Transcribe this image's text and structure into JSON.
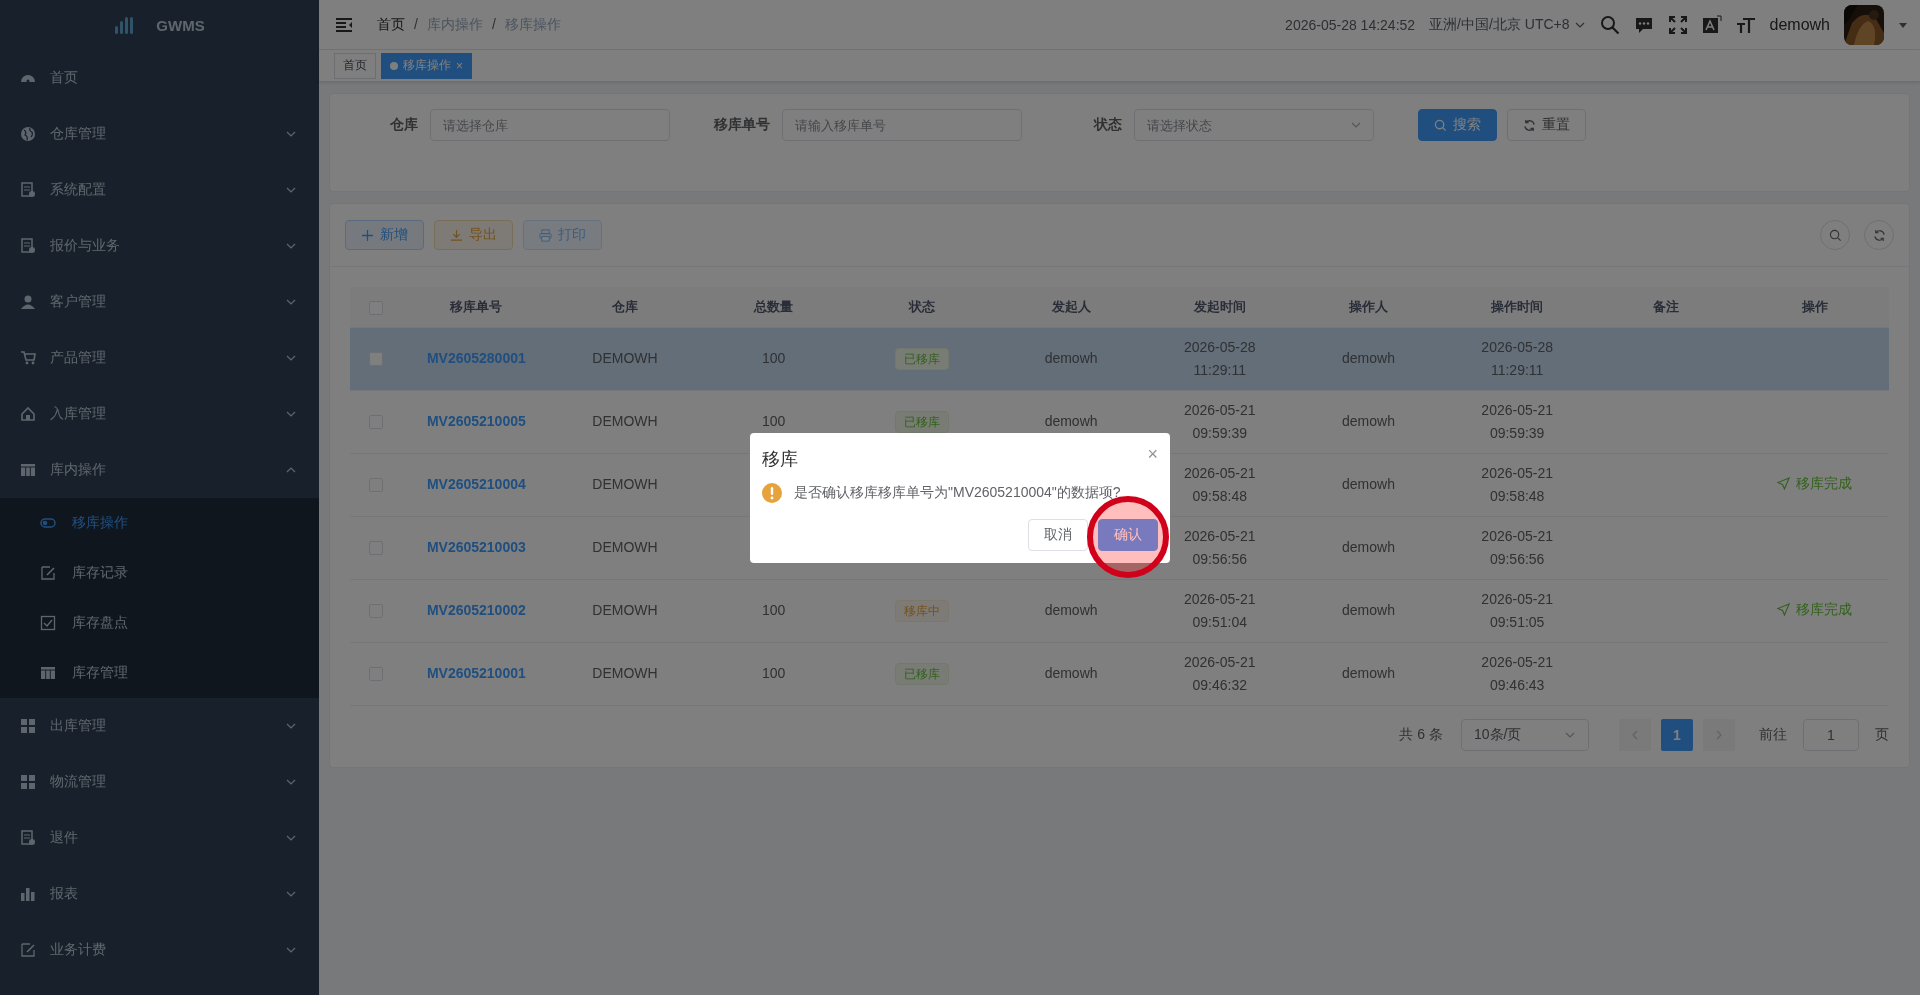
{
  "sidebar": {
    "logo": "GWMS",
    "items": [
      {
        "label": "首页"
      },
      {
        "label": "仓库管理",
        "expanded": false
      },
      {
        "label": "系统配置",
        "expanded": false
      },
      {
        "label": "报价与业务",
        "expanded": false
      },
      {
        "label": "客户管理",
        "expanded": false
      },
      {
        "label": "产品管理",
        "expanded": false
      },
      {
        "label": "入库管理",
        "expanded": false
      },
      {
        "label": "库内操作",
        "expanded": true,
        "children": [
          {
            "label": "移库操作",
            "selected": true
          },
          {
            "label": "库存记录",
            "selected": false
          },
          {
            "label": "库存盘点",
            "selected": false
          },
          {
            "label": "库存管理",
            "selected": false
          }
        ]
      },
      {
        "label": "出库管理",
        "expanded": false
      },
      {
        "label": "物流管理",
        "expanded": false
      },
      {
        "label": "退件",
        "expanded": false
      },
      {
        "label": "报表",
        "expanded": false
      },
      {
        "label": "业务计费",
        "expanded": false
      }
    ]
  },
  "header": {
    "breadcrumb": [
      "首页",
      "库内操作",
      "移库操作"
    ],
    "breadcrumb_separator": "/",
    "datetime": "2026-05-28 14:24:52",
    "timezone": "亚洲/中国/北京 UTC+8",
    "user": "demowh"
  },
  "tabs": [
    {
      "label": "首页",
      "selected": false
    },
    {
      "label": "移库操作",
      "selected": true,
      "close": "×"
    }
  ],
  "filters": [
    {
      "label": "仓库",
      "placeholder": "请选择仓库",
      "kind": "select-plain"
    },
    {
      "label": "移库单号",
      "placeholder": "请输入移库单号",
      "kind": "input"
    },
    {
      "label": "状态",
      "placeholder": "请选择状态",
      "kind": "select"
    }
  ],
  "filter_buttons": [
    {
      "label": "搜索",
      "kind": "primary"
    },
    {
      "label": "重置",
      "kind": "default"
    }
  ],
  "toolbar": [
    {
      "label": "新增",
      "kind": "add",
      "disabled": false
    },
    {
      "label": "导出",
      "kind": "export",
      "disabled": false
    },
    {
      "label": "打印",
      "kind": "print",
      "disabled": true
    }
  ],
  "table": {
    "header_checked": false,
    "columns": [
      "移库单号",
      "仓库",
      "总数量",
      "状态",
      "发起人",
      "发起时间",
      "操作人",
      "操作时间",
      "备注",
      "操作"
    ],
    "rows": [
      {
        "selected": true,
        "checked": false,
        "id": "MV2605280001",
        "warehouse": "DEMOWH",
        "qty": "100",
        "status": {
          "text": "已移库",
          "kind": "done"
        },
        "creator": "demowh",
        "created": [
          "2026-05-28",
          "11:29:11"
        ],
        "operator": "demowh",
        "operated": [
          "2026-05-28",
          "11:29:11"
        ]
      },
      {
        "selected": false,
        "checked": false,
        "id": "MV2605210005",
        "warehouse": "DEMOWH",
        "qty": "100",
        "status": {
          "text": "已移库",
          "kind": "done"
        },
        "creator": "demowh",
        "created": [
          "2026-05-21",
          "09:59:39"
        ],
        "operator": "demowh",
        "operated": [
          "2026-05-21",
          "09:59:39"
        ]
      },
      {
        "selected": false,
        "checked": false,
        "id": "MV2605210004",
        "warehouse": "DEMOWH",
        "created": [
          "2026-05-21",
          "09:58:48"
        ],
        "operator": "demowh",
        "operated": [
          "2026-05-21",
          "09:58:48"
        ],
        "action": "移库完成"
      },
      {
        "selected": false,
        "checked": false,
        "id": "MV2605210003",
        "warehouse": "DEMOWH",
        "created": [
          "2026-05-21",
          "09:56:56"
        ],
        "operator": "demowh",
        "operated": [
          "2026-05-21",
          "09:56:56"
        ]
      },
      {
        "selected": false,
        "checked": false,
        "id": "MV2605210002",
        "warehouse": "DEMOWH",
        "qty": "100",
        "status": {
          "text": "移库中",
          "kind": "pending"
        },
        "creator": "demowh",
        "created": [
          "2026-05-21",
          "09:51:04"
        ],
        "operator": "demowh",
        "operated": [
          "2026-05-21",
          "09:51:05"
        ],
        "action": "移库完成"
      },
      {
        "selected": false,
        "checked": false,
        "id": "MV2605210001",
        "warehouse": "DEMOWH",
        "qty": "100",
        "status": {
          "text": "已移库",
          "kind": "done"
        },
        "creator": "demowh",
        "created": [
          "2026-05-21",
          "09:46:32"
        ],
        "operator": "demowh",
        "operated": [
          "2026-05-21",
          "09:46:43"
        ]
      }
    ]
  },
  "pagination": {
    "total": "共 6 条",
    "page_size": "10条/页",
    "pages": [
      {
        "label": "1",
        "selected": true
      }
    ],
    "goto_label": "前往",
    "goto_value": "1",
    "goto_suffix": "页"
  },
  "dialog": {
    "title": "移库",
    "close": "×",
    "message": "是否确认移库移库单号为\"MV2605210004\"的数据项?",
    "buttons": [
      {
        "label": "取消",
        "kind": "default",
        "highlighted": false
      },
      {
        "label": "确认",
        "kind": "primary",
        "highlighted": true
      }
    ]
  }
}
